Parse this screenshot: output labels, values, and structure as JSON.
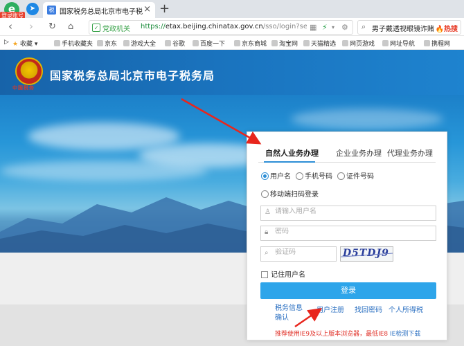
{
  "browser": {
    "login_badge": "登录账号",
    "tab_title": "国家税务总局北京市电子税务局",
    "tab_favicon": "税",
    "gov_label": "党政机关",
    "url_https": "https://",
    "url_host": "etax.beijing.chinatax.gov.cn",
    "url_path": "/sso/login?servi",
    "search_query": "男子戴透视眼镜诈赌",
    "hot_label": "热搜"
  },
  "bookmarks": [
    "收藏",
    "手机收藏夹",
    "京东",
    "游戏大全",
    "谷歌",
    "百度一下",
    "京东商城",
    "淘宝网",
    "天猫精选",
    "网页游戏",
    "网址导航",
    "携程网"
  ],
  "header": {
    "title": "国家税务总局北京市电子税务局",
    "emblem_text": "中国税务"
  },
  "login": {
    "tabs": [
      "自然人业务办理",
      "企业业务办理",
      "代理业务办理"
    ],
    "login_modes": [
      "用户名",
      "手机号码",
      "证件号码",
      "移动端扫码登录"
    ],
    "username_placeholder": "请输入用户名",
    "password_placeholder": "密码",
    "captcha_placeholder": "验证码",
    "captcha_text": "D5TDJ9",
    "remember_label": "记住用户名",
    "login_button": "登录",
    "links": [
      "税务信息确认",
      "用户注册",
      "找回密码",
      "个人所得税"
    ],
    "tip_red": "推荐使用IE9及以上版本浏览器，最低IE8",
    "tip_blue": "IE检测下载"
  },
  "colors": {
    "header_blue": "#1a74bf",
    "login_button": "#2ea5ea",
    "tab_accent": "#2c8ed6",
    "tip_red": "#e1342b",
    "annotation_red": "#e8261d"
  }
}
